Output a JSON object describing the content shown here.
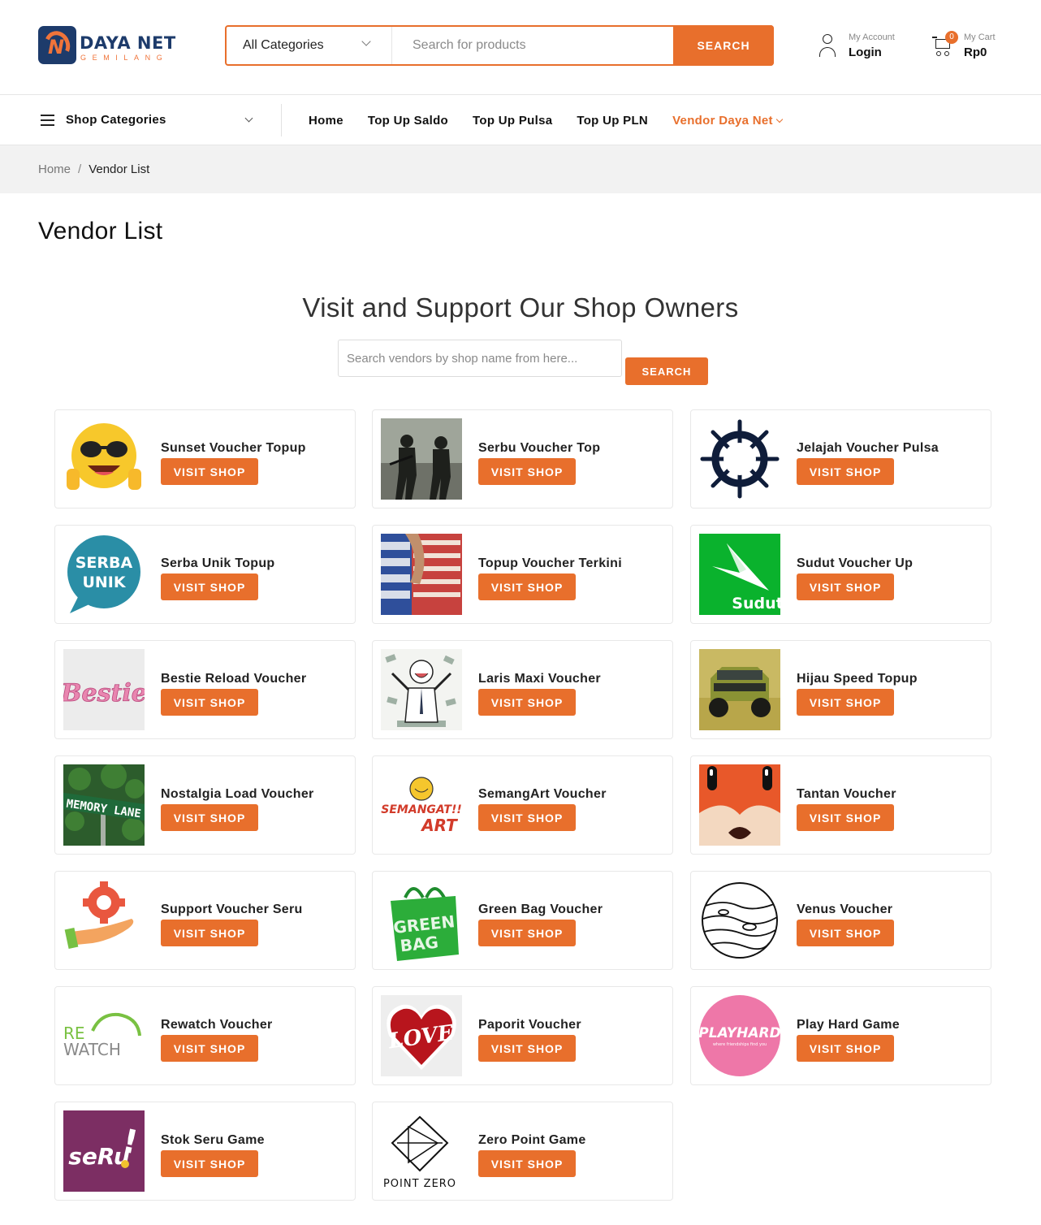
{
  "brand": {
    "name": "DAYA NET",
    "tagline": "GEMILANG"
  },
  "search": {
    "category_selected": "All Categories",
    "placeholder": "Search for products",
    "button_label": "SEARCH"
  },
  "account": {
    "label": "My Account",
    "action": "Login"
  },
  "cart": {
    "label": "My Cart",
    "total": "Rp0",
    "count": "0"
  },
  "nav": {
    "shop_categories": "Shop Categories",
    "links": [
      "Home",
      "Top Up Saldo",
      "Top Up Pulsa",
      "Top Up PLN",
      "Vendor Daya Net"
    ]
  },
  "breadcrumb": {
    "home": "Home",
    "separator": "/",
    "current": "Vendor List"
  },
  "page_title": "Vendor List",
  "section_title": "Visit and Support Our Shop Owners",
  "vendor_search": {
    "placeholder": "Search vendors by shop name from here...",
    "button_label": "SEARCH"
  },
  "visit_label": "VISIT SHOP",
  "vendors": [
    {
      "name": "Sunset Voucher Topup",
      "logo": "sunglasses-emoji-logo"
    },
    {
      "name": "Serbu Voucher Top",
      "logo": "soldiers-photo"
    },
    {
      "name": "Jelajah Voucher Pulsa",
      "logo": "ship-wheel-logo"
    },
    {
      "name": "Serba Unik Topup",
      "logo": "serba-unik-bubble-logo",
      "logo_text": "SERBA UNIK"
    },
    {
      "name": "Topup Voucher Terkini",
      "logo": "voucher-cards-photo"
    },
    {
      "name": "Sudut Voucher Up",
      "logo": "sudut-arrow-logo",
      "logo_text": "Sudut"
    },
    {
      "name": "Bestie Reload Voucher",
      "logo": "bestie-script-logo",
      "logo_text": "Bestie"
    },
    {
      "name": "Laris Maxi Voucher",
      "logo": "money-rain-illustration"
    },
    {
      "name": "Hijau Speed Topup",
      "logo": "offroad-car-photo"
    },
    {
      "name": "Nostalgia Load Voucher",
      "logo": "memory-lane-sign-photo",
      "logo_text": "MEMORY LANE"
    },
    {
      "name": "SemangArt Voucher",
      "logo": "semangat-art-logo",
      "logo_text": "SEMANGAT!! ART"
    },
    {
      "name": "Tantan Voucher",
      "logo": "fox-face-logo"
    },
    {
      "name": "Support Voucher Seru",
      "logo": "gear-hand-logo"
    },
    {
      "name": "Green Bag Voucher",
      "logo": "green-bag-logo",
      "logo_text": "GREEN BAG"
    },
    {
      "name": "Venus Voucher",
      "logo": "planet-lineart-logo"
    },
    {
      "name": "Rewatch Voucher",
      "logo": "rewatch-logo",
      "logo_text": "REWATCH"
    },
    {
      "name": "Paporit Voucher",
      "logo": "love-heart-logo",
      "logo_text": "LOVE"
    },
    {
      "name": "Play Hard Game",
      "logo": "playhard-circle-logo",
      "logo_text": "PLAYHARD",
      "logo_subtext": "where friendships find you"
    },
    {
      "name": "Stok Seru Game",
      "logo": "seru-logo",
      "logo_text": "seRu!"
    },
    {
      "name": "Zero Point Game",
      "logo": "point-zero-logo",
      "logo_text": "POINT ZERO"
    }
  ],
  "colors": {
    "accent": "#e86f2c",
    "brand_navy": "#1d3b6b",
    "breadcrumb_bg": "#f2f2f2"
  }
}
